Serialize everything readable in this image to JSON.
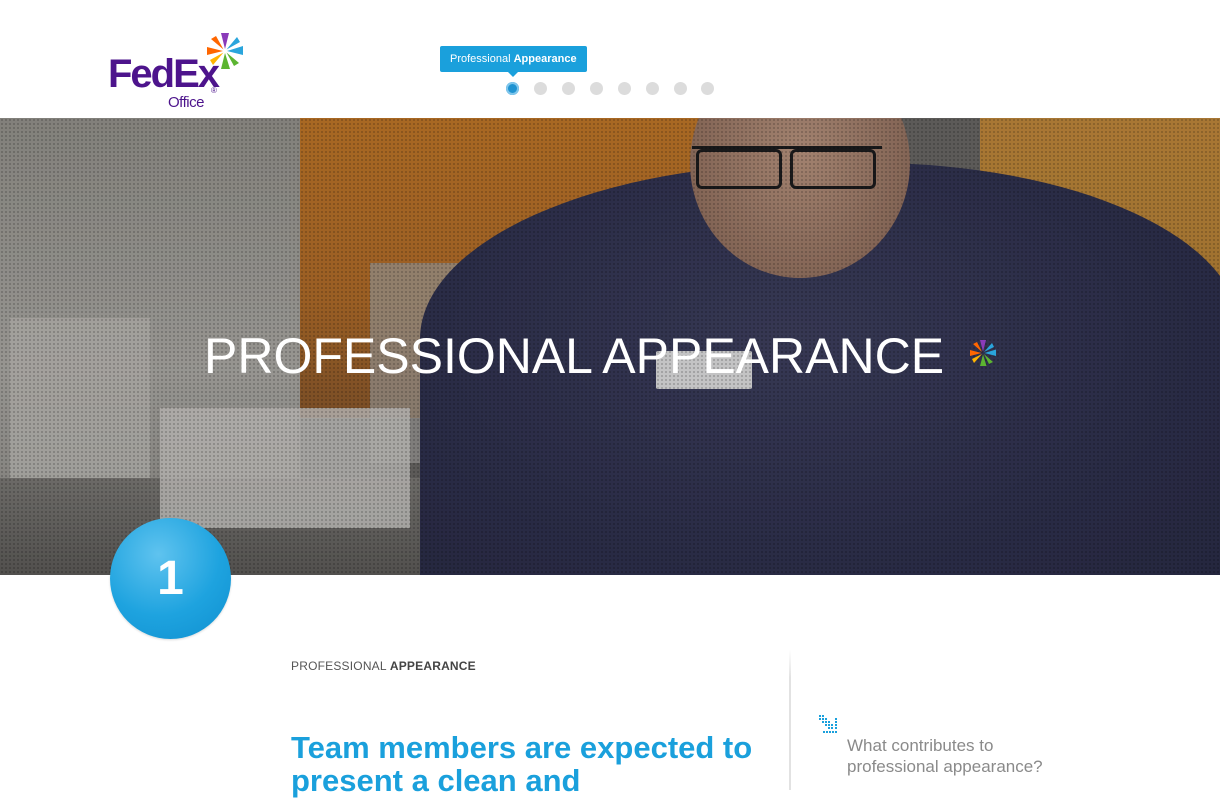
{
  "header": {
    "logo": {
      "brand": "FedEx",
      "sub": "Office",
      "reg": "®"
    },
    "tooltip": {
      "light": "Professional ",
      "bold": "Appearance"
    },
    "nav_dots": {
      "count": 8,
      "active_index": 0
    }
  },
  "hero": {
    "title_light": "PROFESSIONAL ",
    "title_bold": "APPEARANCE"
  },
  "badge": {
    "number": "1"
  },
  "content": {
    "section_label_light": "PROFESSIONAL ",
    "section_label_bold": "APPEARANCE",
    "headline": "Team members are expected to present a clean and",
    "side_question": "What contributes to professional appearance?"
  },
  "colors": {
    "accent_blue": "#1aa0dc",
    "fedex_purple": "#4d148c",
    "fedex_orange": "#ff6600",
    "dot_inactive": "#dcdcdc"
  }
}
